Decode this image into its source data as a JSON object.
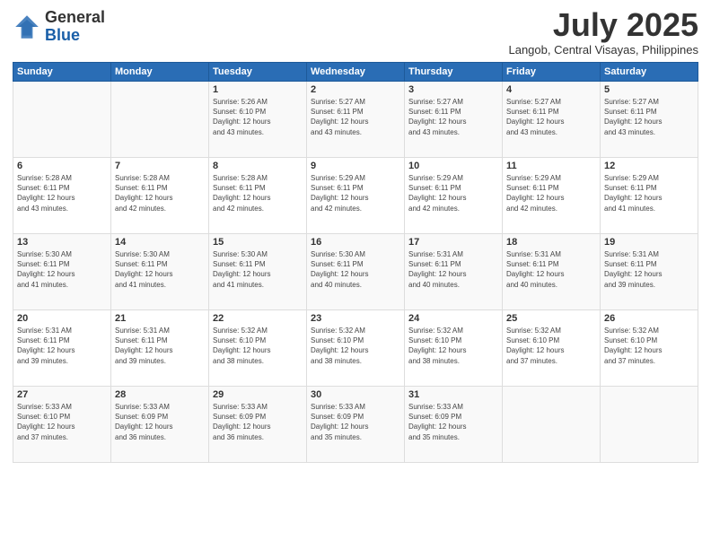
{
  "logo": {
    "general": "General",
    "blue": "Blue"
  },
  "title": "July 2025",
  "location": "Langob, Central Visayas, Philippines",
  "weekdays": [
    "Sunday",
    "Monday",
    "Tuesday",
    "Wednesday",
    "Thursday",
    "Friday",
    "Saturday"
  ],
  "weeks": [
    [
      {
        "day": "",
        "info": ""
      },
      {
        "day": "",
        "info": ""
      },
      {
        "day": "1",
        "info": "Sunrise: 5:26 AM\nSunset: 6:10 PM\nDaylight: 12 hours\nand 43 minutes."
      },
      {
        "day": "2",
        "info": "Sunrise: 5:27 AM\nSunset: 6:11 PM\nDaylight: 12 hours\nand 43 minutes."
      },
      {
        "day": "3",
        "info": "Sunrise: 5:27 AM\nSunset: 6:11 PM\nDaylight: 12 hours\nand 43 minutes."
      },
      {
        "day": "4",
        "info": "Sunrise: 5:27 AM\nSunset: 6:11 PM\nDaylight: 12 hours\nand 43 minutes."
      },
      {
        "day": "5",
        "info": "Sunrise: 5:27 AM\nSunset: 6:11 PM\nDaylight: 12 hours\nand 43 minutes."
      }
    ],
    [
      {
        "day": "6",
        "info": "Sunrise: 5:28 AM\nSunset: 6:11 PM\nDaylight: 12 hours\nand 43 minutes."
      },
      {
        "day": "7",
        "info": "Sunrise: 5:28 AM\nSunset: 6:11 PM\nDaylight: 12 hours\nand 42 minutes."
      },
      {
        "day": "8",
        "info": "Sunrise: 5:28 AM\nSunset: 6:11 PM\nDaylight: 12 hours\nand 42 minutes."
      },
      {
        "day": "9",
        "info": "Sunrise: 5:29 AM\nSunset: 6:11 PM\nDaylight: 12 hours\nand 42 minutes."
      },
      {
        "day": "10",
        "info": "Sunrise: 5:29 AM\nSunset: 6:11 PM\nDaylight: 12 hours\nand 42 minutes."
      },
      {
        "day": "11",
        "info": "Sunrise: 5:29 AM\nSunset: 6:11 PM\nDaylight: 12 hours\nand 42 minutes."
      },
      {
        "day": "12",
        "info": "Sunrise: 5:29 AM\nSunset: 6:11 PM\nDaylight: 12 hours\nand 41 minutes."
      }
    ],
    [
      {
        "day": "13",
        "info": "Sunrise: 5:30 AM\nSunset: 6:11 PM\nDaylight: 12 hours\nand 41 minutes."
      },
      {
        "day": "14",
        "info": "Sunrise: 5:30 AM\nSunset: 6:11 PM\nDaylight: 12 hours\nand 41 minutes."
      },
      {
        "day": "15",
        "info": "Sunrise: 5:30 AM\nSunset: 6:11 PM\nDaylight: 12 hours\nand 41 minutes."
      },
      {
        "day": "16",
        "info": "Sunrise: 5:30 AM\nSunset: 6:11 PM\nDaylight: 12 hours\nand 40 minutes."
      },
      {
        "day": "17",
        "info": "Sunrise: 5:31 AM\nSunset: 6:11 PM\nDaylight: 12 hours\nand 40 minutes."
      },
      {
        "day": "18",
        "info": "Sunrise: 5:31 AM\nSunset: 6:11 PM\nDaylight: 12 hours\nand 40 minutes."
      },
      {
        "day": "19",
        "info": "Sunrise: 5:31 AM\nSunset: 6:11 PM\nDaylight: 12 hours\nand 39 minutes."
      }
    ],
    [
      {
        "day": "20",
        "info": "Sunrise: 5:31 AM\nSunset: 6:11 PM\nDaylight: 12 hours\nand 39 minutes."
      },
      {
        "day": "21",
        "info": "Sunrise: 5:31 AM\nSunset: 6:11 PM\nDaylight: 12 hours\nand 39 minutes."
      },
      {
        "day": "22",
        "info": "Sunrise: 5:32 AM\nSunset: 6:10 PM\nDaylight: 12 hours\nand 38 minutes."
      },
      {
        "day": "23",
        "info": "Sunrise: 5:32 AM\nSunset: 6:10 PM\nDaylight: 12 hours\nand 38 minutes."
      },
      {
        "day": "24",
        "info": "Sunrise: 5:32 AM\nSunset: 6:10 PM\nDaylight: 12 hours\nand 38 minutes."
      },
      {
        "day": "25",
        "info": "Sunrise: 5:32 AM\nSunset: 6:10 PM\nDaylight: 12 hours\nand 37 minutes."
      },
      {
        "day": "26",
        "info": "Sunrise: 5:32 AM\nSunset: 6:10 PM\nDaylight: 12 hours\nand 37 minutes."
      }
    ],
    [
      {
        "day": "27",
        "info": "Sunrise: 5:33 AM\nSunset: 6:10 PM\nDaylight: 12 hours\nand 37 minutes."
      },
      {
        "day": "28",
        "info": "Sunrise: 5:33 AM\nSunset: 6:09 PM\nDaylight: 12 hours\nand 36 minutes."
      },
      {
        "day": "29",
        "info": "Sunrise: 5:33 AM\nSunset: 6:09 PM\nDaylight: 12 hours\nand 36 minutes."
      },
      {
        "day": "30",
        "info": "Sunrise: 5:33 AM\nSunset: 6:09 PM\nDaylight: 12 hours\nand 35 minutes."
      },
      {
        "day": "31",
        "info": "Sunrise: 5:33 AM\nSunset: 6:09 PM\nDaylight: 12 hours\nand 35 minutes."
      },
      {
        "day": "",
        "info": ""
      },
      {
        "day": "",
        "info": ""
      }
    ]
  ]
}
